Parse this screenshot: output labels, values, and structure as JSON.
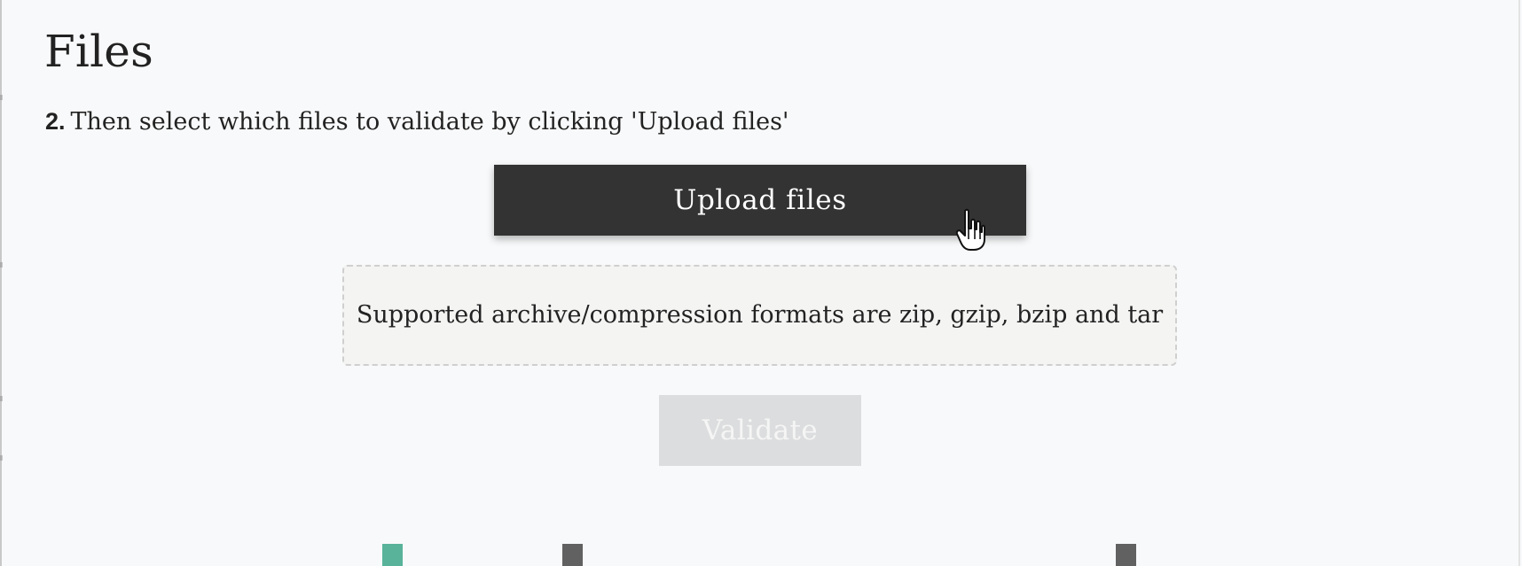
{
  "header": {
    "title": "Files"
  },
  "instructions": {
    "step_number": "2.",
    "step_text": "Then select which files to validate by clicking 'Upload files'"
  },
  "actions": {
    "upload_label": "Upload files",
    "validate_label": "Validate"
  },
  "formats": {
    "text": "Supported archive/compression formats are zip, gzip, bzip and tar"
  },
  "colors": {
    "primary_button": "#333333",
    "disabled_button": "#dcddde",
    "accent_teal": "#58b39a",
    "accent_gray": "#616161"
  },
  "icons": {
    "cursor": "hand-pointer-icon"
  }
}
